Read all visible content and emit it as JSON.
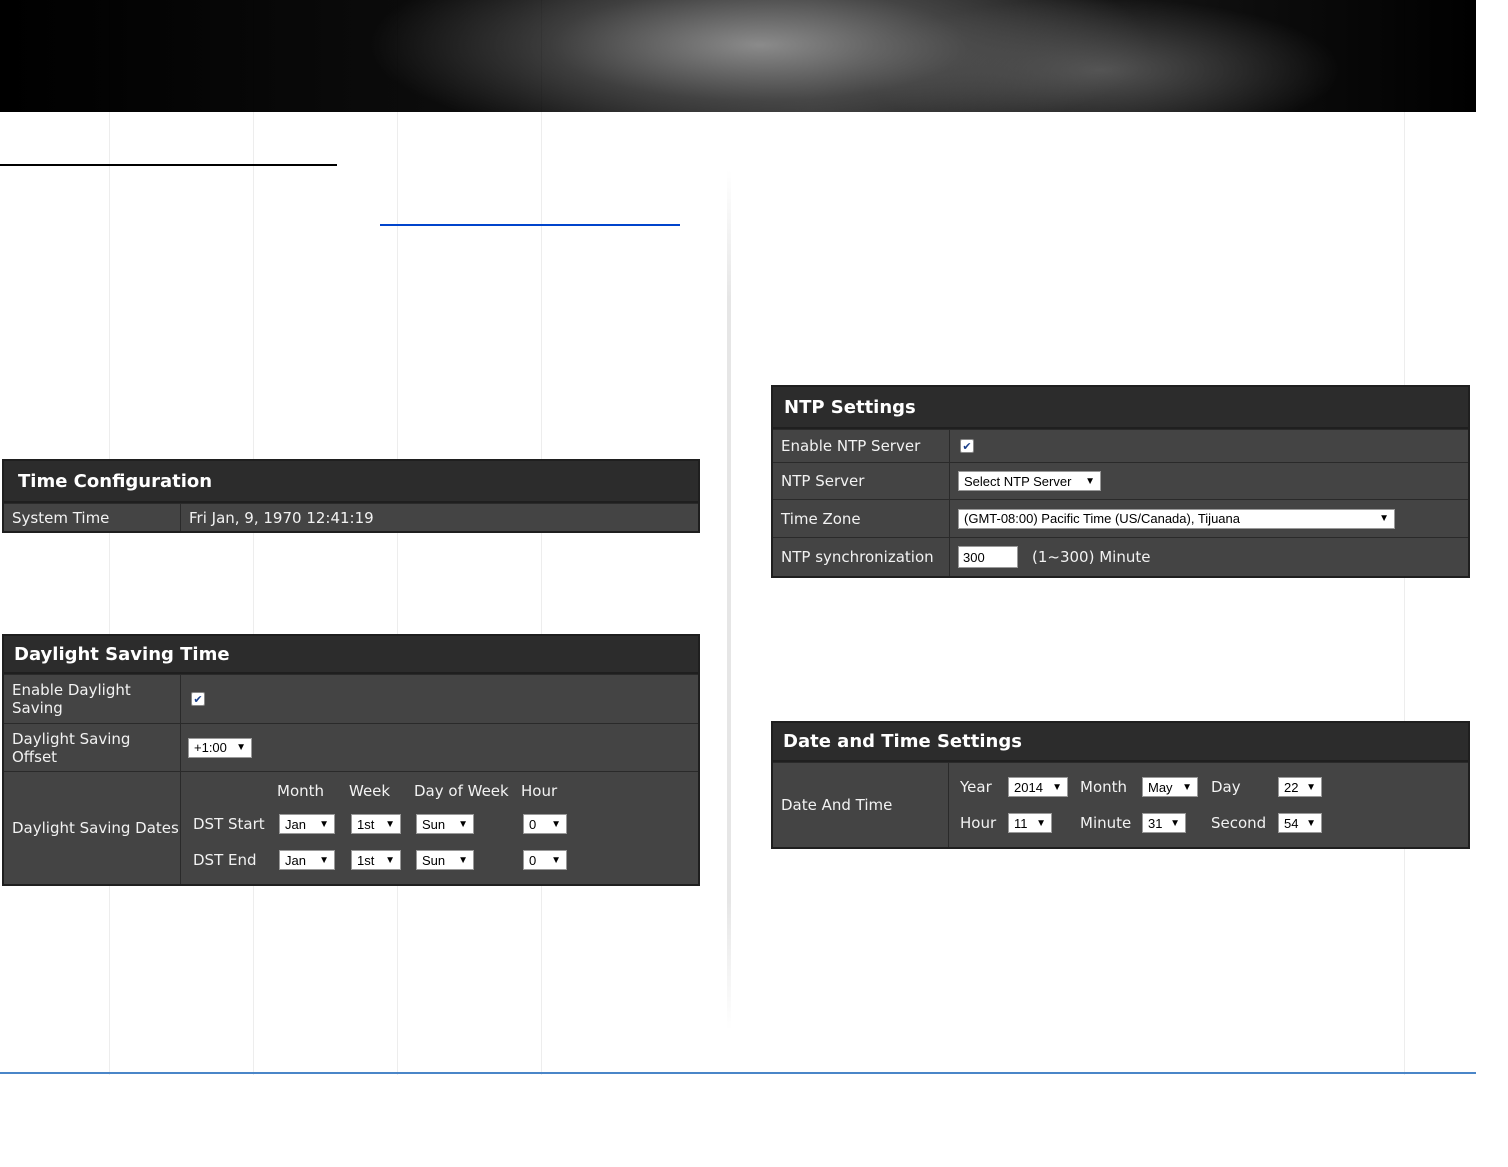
{
  "time_config": {
    "title": "Time Configuration",
    "system_time_label": "System Time",
    "system_time_value": "Fri Jan, 9, 1970 12:41:19"
  },
  "dst": {
    "title": "Daylight Saving Time",
    "enable_label": "Enable Daylight Saving",
    "enable_checked": true,
    "offset_label": "Daylight Saving Offset",
    "offset_value": "+1:00",
    "dates_label": "Daylight Saving Dates",
    "col_month": "Month",
    "col_week": "Week",
    "col_dow": "Day of Week",
    "col_hour": "Hour",
    "start_label": "DST Start",
    "end_label": "DST End",
    "start": {
      "month": "Jan",
      "week": "1st",
      "dow": "Sun",
      "hour": "0"
    },
    "end": {
      "month": "Jan",
      "week": "1st",
      "dow": "Sun",
      "hour": "0"
    }
  },
  "ntp": {
    "title": "NTP Settings",
    "enable_label": "Enable NTP Server",
    "enable_checked": true,
    "server_label": "NTP Server",
    "server_value": "Select NTP Server",
    "zone_label": "Time Zone",
    "zone_value": "(GMT-08:00) Pacific Time (US/Canada), Tijuana",
    "sync_label": "NTP synchronization",
    "sync_value": "300",
    "sync_unit": "(1~300) Minute"
  },
  "datetime": {
    "title": "Date and Time Settings",
    "label": "Date And Time",
    "year_label": "Year",
    "year_value": "2014",
    "month_label": "Month",
    "month_value": "May",
    "day_label": "Day",
    "day_value": "22",
    "hour_label": "Hour",
    "hour_value": "11",
    "minute_label": "Minute",
    "minute_value": "31",
    "second_label": "Second",
    "second_value": "54"
  },
  "icons": {
    "arrow": "▼",
    "check": "✔"
  }
}
